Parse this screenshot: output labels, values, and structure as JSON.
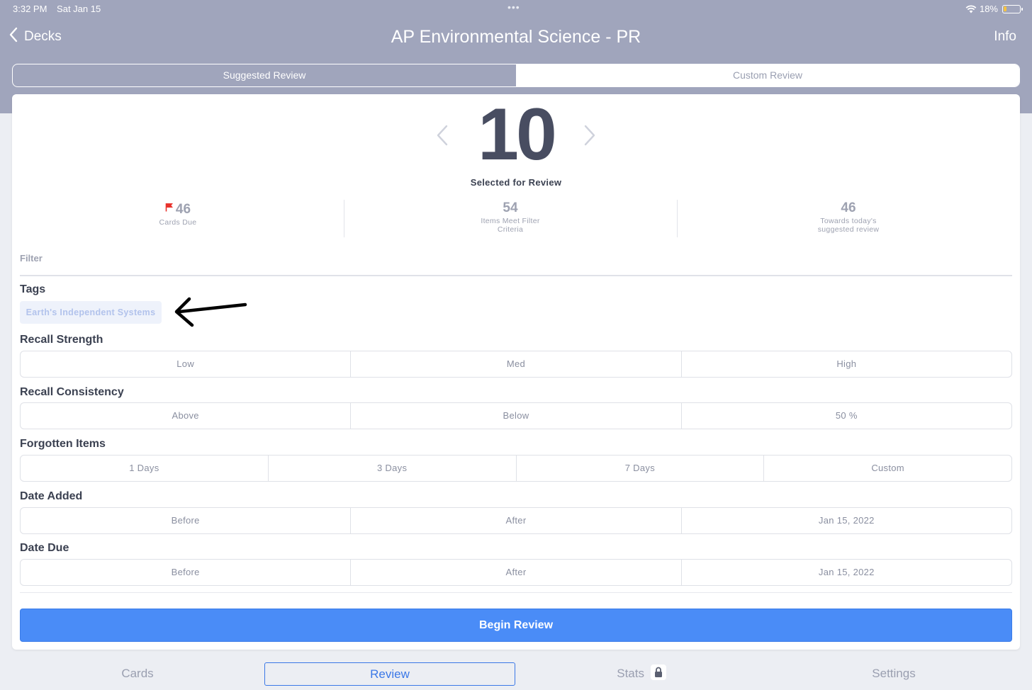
{
  "status_bar": {
    "time": "3:32 PM",
    "date": "Sat Jan 15",
    "battery": "18%",
    "battery_level": 0.18
  },
  "nav": {
    "back_label": "Decks",
    "title": "AP Environmental Science - PR",
    "info_label": "Info"
  },
  "mode_tabs": {
    "suggested": "Suggested Review",
    "custom": "Custom Review",
    "selected": "Suggested Review"
  },
  "review": {
    "count": "10",
    "count_label": "Selected for Review"
  },
  "stats": [
    {
      "value": "46",
      "label": "Cards Due",
      "icon": "red-flag-icon"
    },
    {
      "value": "54",
      "label": "Items Meet Filter Criteria"
    },
    {
      "value": "46",
      "label": "Towards today's suggested review"
    }
  ],
  "filter": {
    "label": "Filter",
    "tags": {
      "title": "Tags",
      "chip": "Earth's Independent Systems"
    },
    "recall_strength": {
      "title": "Recall Strength",
      "options": [
        "Low",
        "Med",
        "High"
      ]
    },
    "recall_consistency": {
      "title": "Recall Consistency",
      "options": [
        "Above",
        "Below",
        "50 %"
      ]
    },
    "forgotten_items": {
      "title": "Forgotten Items",
      "options": [
        "1 Days",
        "3 Days",
        "7 Days",
        "Custom"
      ]
    },
    "date_added": {
      "title": "Date Added",
      "options": [
        "Before",
        "After",
        "Jan 15, 2022"
      ]
    },
    "date_due": {
      "title": "Date Due",
      "options": [
        "Before",
        "After",
        "Jan 15, 2022"
      ]
    }
  },
  "begin_button": "Begin Review",
  "tabbar": {
    "cards": "Cards",
    "review": "Review",
    "stats": "Stats",
    "settings": "Settings",
    "active": "Review"
  },
  "colors": {
    "header": "#a0a5bc",
    "accent": "#4a8cf7",
    "flag": "#e8322c",
    "annotation": "#000000"
  }
}
